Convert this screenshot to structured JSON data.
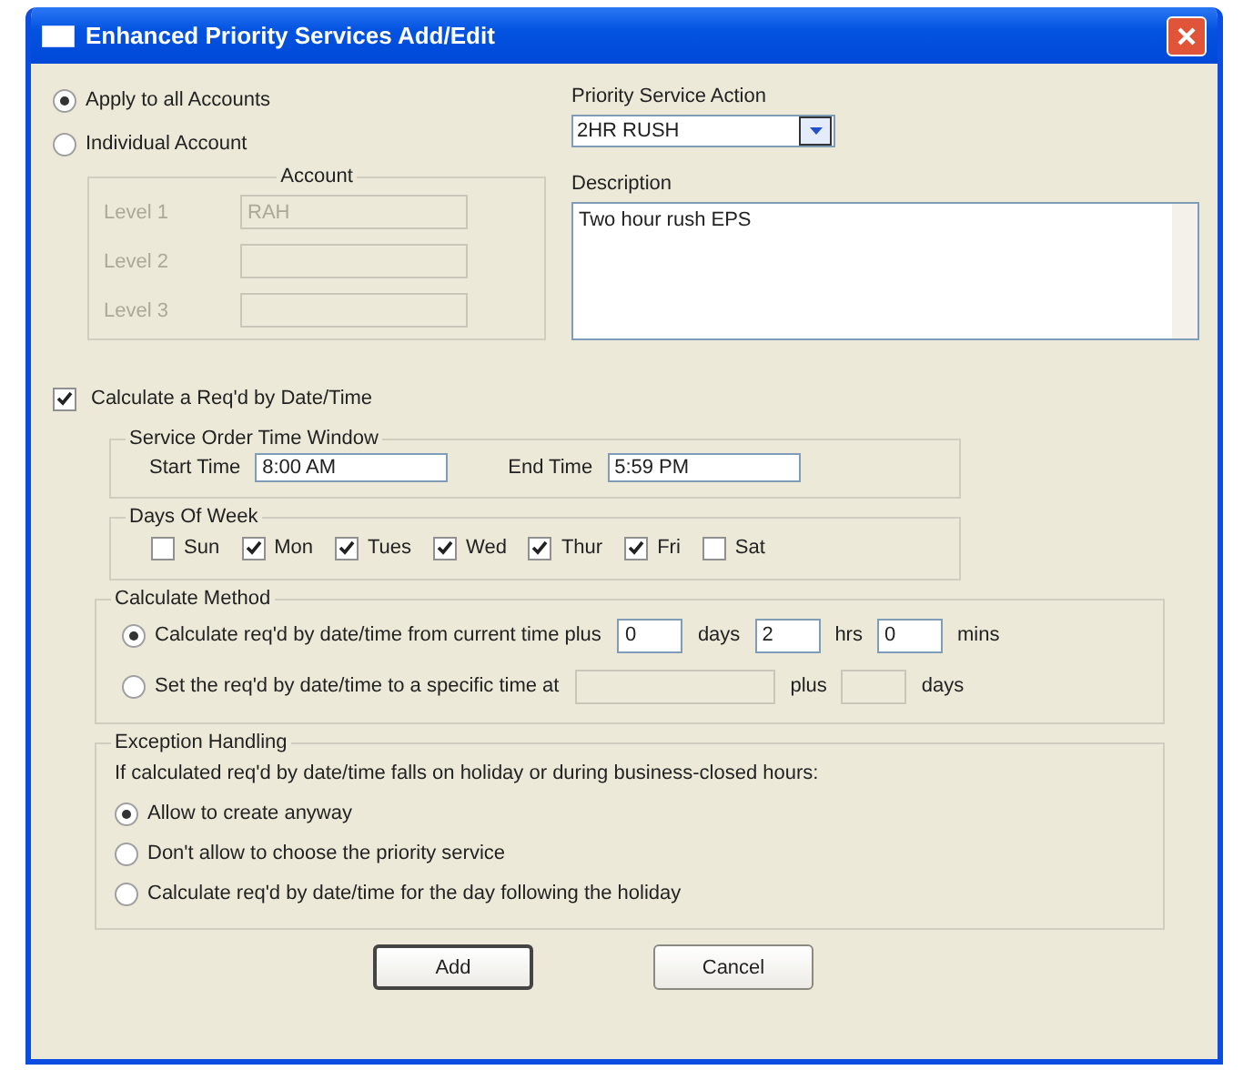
{
  "window": {
    "title": "Enhanced Priority Services Add/Edit"
  },
  "scope": [
    {
      "label": "Apply to all Accounts",
      "selected": true
    },
    {
      "label": "Individual Account",
      "selected": false
    }
  ],
  "account": {
    "title": "Account",
    "disabled": true,
    "levels": [
      {
        "label": "Level 1",
        "value": "RAH"
      },
      {
        "label": "Level 2"
      },
      {
        "label": "Level 3"
      }
    ]
  },
  "priority_service_action": {
    "label": "Priority Service Action",
    "value": "2HR RUSH"
  },
  "description": {
    "label": "Description",
    "value": "Two hour rush EPS"
  },
  "calculate": {
    "label": "Calculate a Req'd by Date/Time",
    "checked": true
  },
  "time_window": {
    "title": "Service Order Time Window",
    "fields": [
      {
        "label": "Start Time",
        "value": "8:00 AM"
      },
      {
        "label": "End Time",
        "value": "5:59 PM"
      }
    ]
  },
  "days": {
    "title": "Days Of Week",
    "items": [
      {
        "label": "Sun",
        "checked": false
      },
      {
        "label": "Mon",
        "checked": true
      },
      {
        "label": "Tues",
        "checked": true
      },
      {
        "label": "Wed",
        "checked": true
      },
      {
        "label": "Thur",
        "checked": true
      },
      {
        "label": "Fri",
        "checked": true
      },
      {
        "label": "Sat",
        "checked": false
      }
    ]
  },
  "method": {
    "title": "Calculate Method",
    "options": [
      {
        "label": "Calculate req'd by date/time from current time plus",
        "selected": true,
        "parts": [
          {
            "value": "0",
            "unit": "days",
            "disabled": false
          },
          {
            "value": "2",
            "unit": "hrs",
            "disabled": false
          },
          {
            "value": "0",
            "unit": "mins",
            "disabled": false
          }
        ]
      },
      {
        "label": "Set the req'd by date/time to a specific time at",
        "selected": false,
        "parts": [
          {
            "unit": "plus",
            "disabled": true,
            "wide": true
          },
          {
            "unit": "days",
            "disabled": true,
            "wide": false
          }
        ]
      }
    ]
  },
  "exception": {
    "title": "Exception Handling",
    "note": "If calculated req'd by date/time falls on holiday or during business-closed hours:",
    "options": [
      {
        "label": "Allow to create anyway",
        "selected": true
      },
      {
        "label": "Don't allow to choose the priority service",
        "selected": false
      },
      {
        "label": "Calculate req'd by date/time for the day following the holiday",
        "selected": false
      }
    ]
  },
  "buttons": [
    {
      "label": "Add",
      "default": true
    },
    {
      "label": "Cancel",
      "default": false
    }
  ]
}
